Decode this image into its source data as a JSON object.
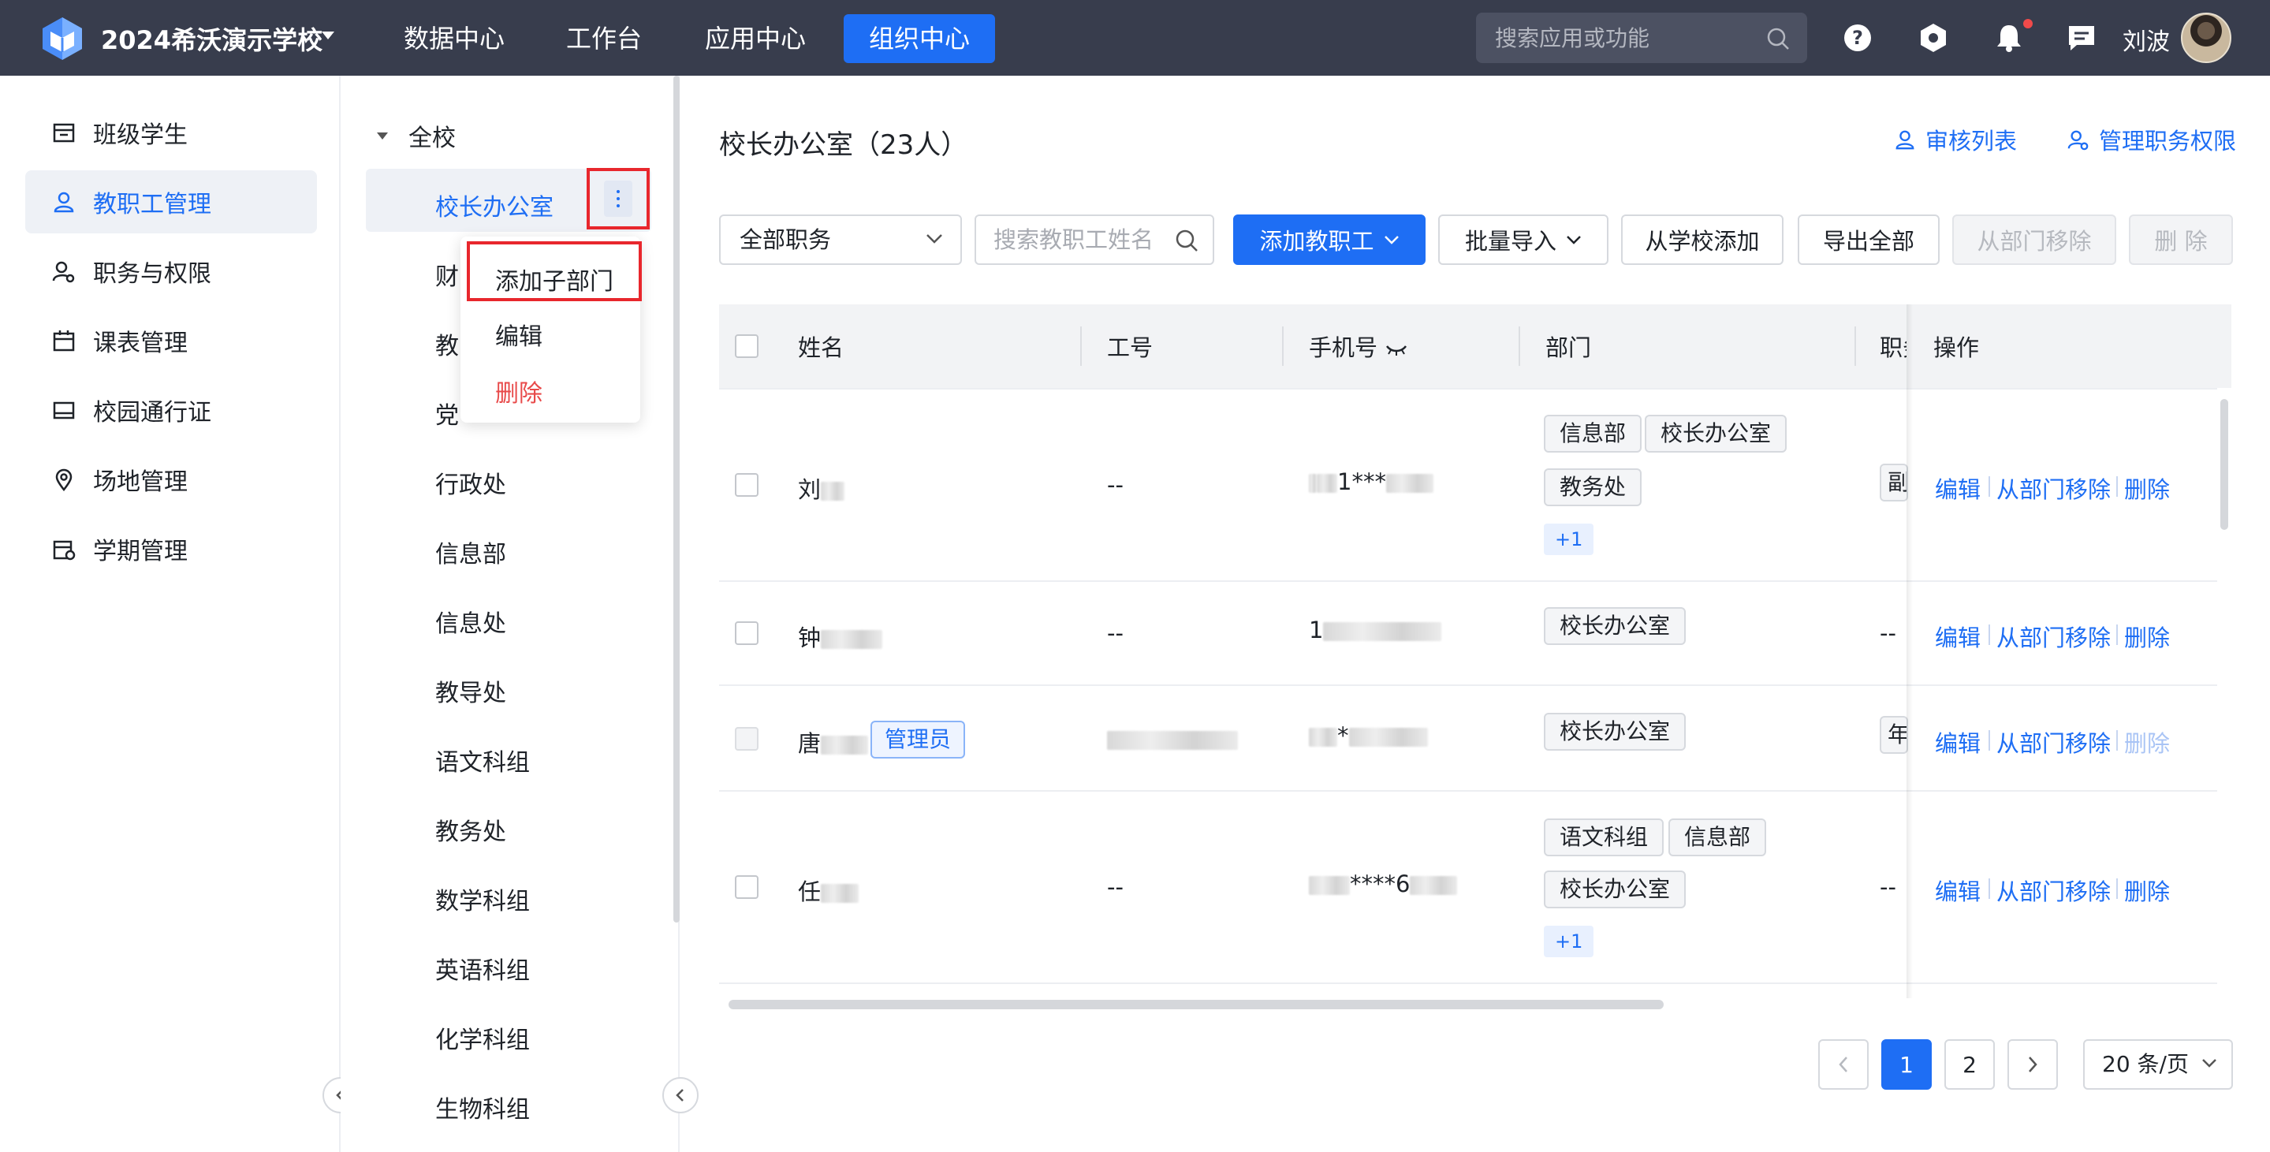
{
  "header": {
    "school_name": "2024希沃演示学校",
    "nav": [
      {
        "label": "数据中心"
      },
      {
        "label": "工作台"
      },
      {
        "label": "应用中心"
      },
      {
        "label": "组织中心",
        "active": true
      }
    ],
    "search_placeholder": "搜索应用或功能",
    "user_name": "刘波",
    "icons": [
      "help-icon",
      "settings-hexagon-icon",
      "bell-icon",
      "message-icon"
    ]
  },
  "sidebar": {
    "items": [
      {
        "label": "班级学生",
        "icon": "class-icon"
      },
      {
        "label": "教职工管理",
        "icon": "user-icon",
        "active": true
      },
      {
        "label": "职务与权限",
        "icon": "role-icon"
      },
      {
        "label": "课表管理",
        "icon": "calendar-icon"
      },
      {
        "label": "校园通行证",
        "icon": "card-icon"
      },
      {
        "label": "场地管理",
        "icon": "location-icon"
      },
      {
        "label": "学期管理",
        "icon": "term-icon"
      }
    ]
  },
  "tree": {
    "root": "全校",
    "items": [
      "校长办公室",
      "财",
      "教",
      "党",
      "行政处",
      "信息部",
      "信息处",
      "教导处",
      "语文科组",
      "教务处",
      "数学科组",
      "英语科组",
      "化学科组",
      "生物科组"
    ],
    "menu": {
      "add_child": "添加子部门",
      "edit": "编辑",
      "delete": "删除"
    }
  },
  "main": {
    "title": "校长办公室（23人）",
    "review_link": "审核列表",
    "manage_link": "管理职务权限",
    "toolbar": {
      "position_select": "全部职务",
      "search_placeholder": "搜索教职工姓名",
      "add_staff": "添加教职工",
      "batch_import": "批量导入",
      "add_from_school": "从学校添加",
      "export_all": "导出全部",
      "remove_from_dept": "从部门移除",
      "delete": "删 除"
    },
    "table": {
      "headers": {
        "name": "姓名",
        "job_no": "工号",
        "phone": "手机号",
        "dept": "部门",
        "position": "职务",
        "actions": "操作"
      },
      "rows": [
        {
          "name": "刘",
          "job_no": "--",
          "phone": "1***",
          "depts": [
            "信息部",
            "校长办公室",
            "教务处"
          ],
          "more": "+1",
          "position": "副"
        },
        {
          "name": "钟",
          "job_no": "--",
          "phone": "1",
          "depts": [
            "校长办公室"
          ],
          "position": "--"
        },
        {
          "name": "唐",
          "admin": "管理员",
          "job_no": "",
          "phone": "*",
          "depts": [
            "校长办公室"
          ],
          "position": "年"
        },
        {
          "name": "任",
          "job_no": "--",
          "phone": "****6",
          "depts": [
            "语文科组",
            "信息部",
            "校长办公室"
          ],
          "more": "+1",
          "position": "--"
        }
      ],
      "actions": {
        "edit": "编辑",
        "remove": "从部门移除",
        "delete": "删除"
      }
    },
    "pagination": {
      "pages": [
        "1",
        "2"
      ],
      "current": "1",
      "page_size": "20 条/页"
    }
  }
}
